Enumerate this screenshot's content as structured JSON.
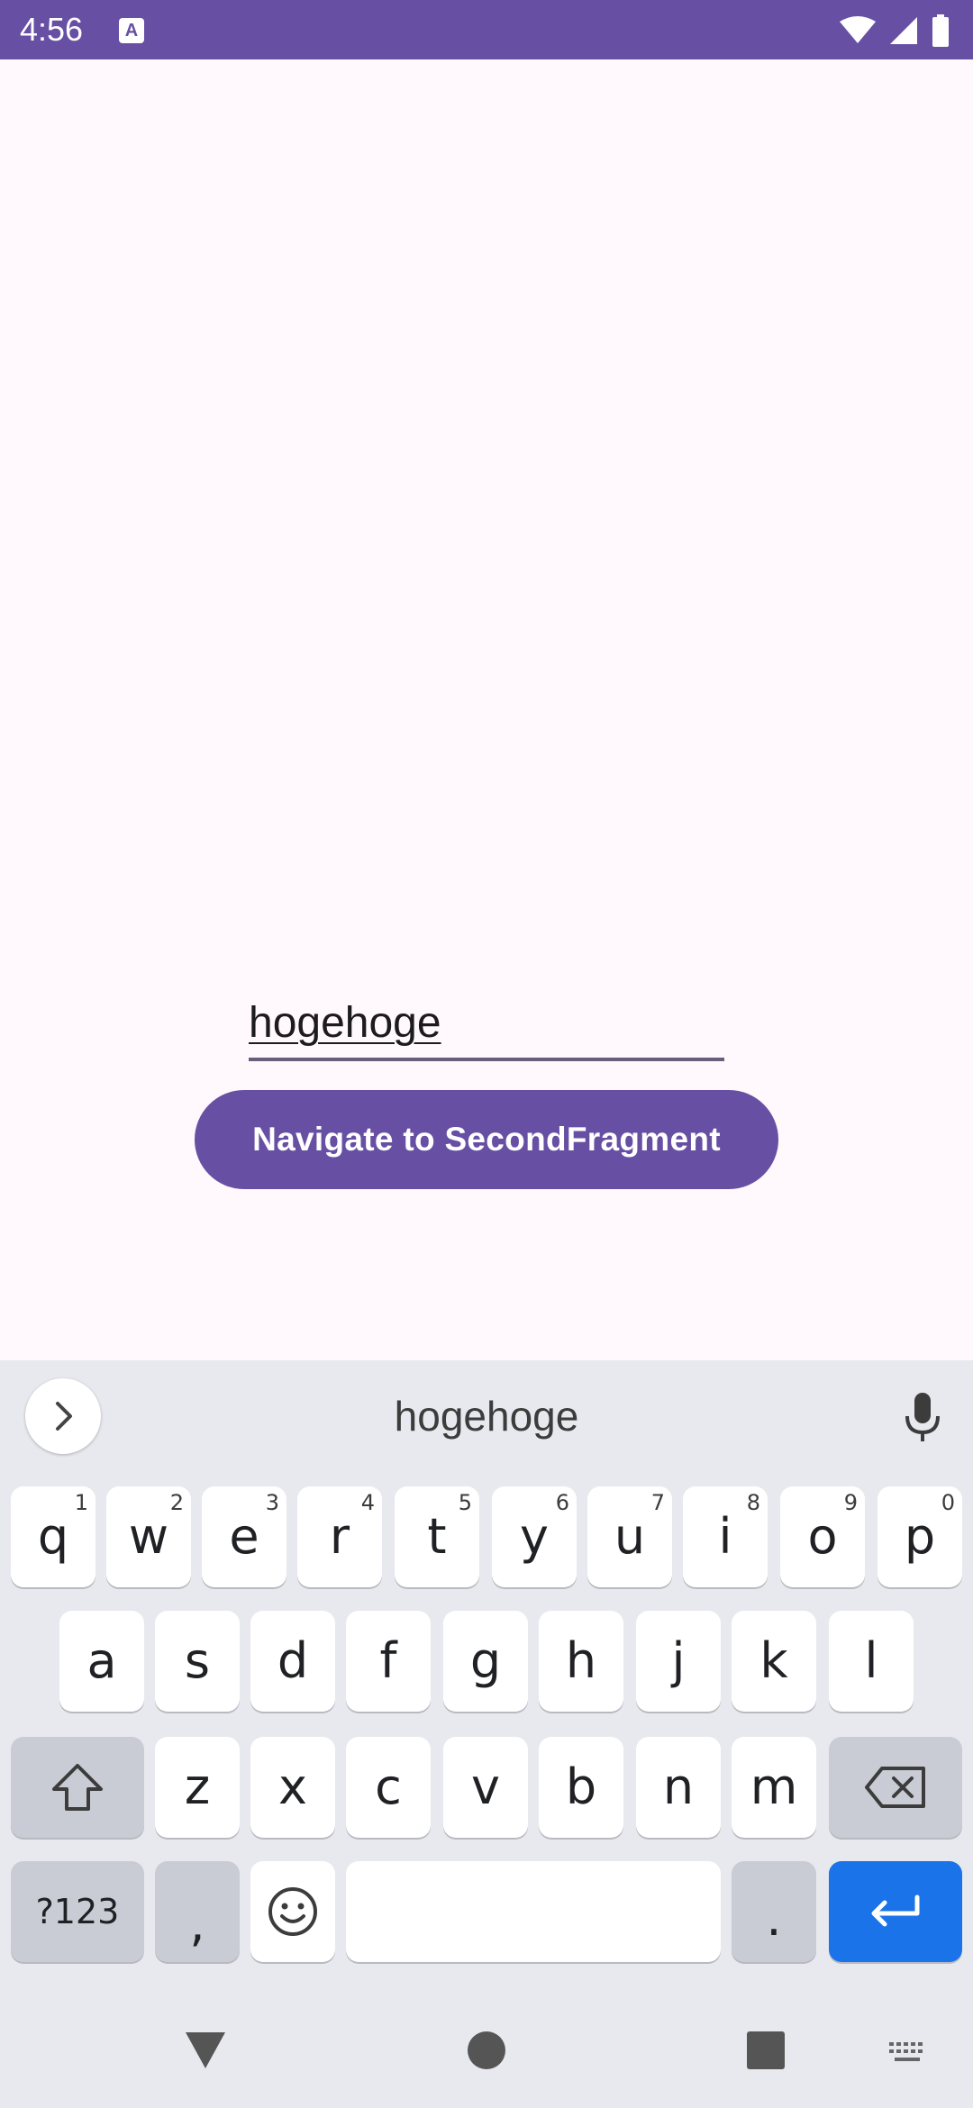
{
  "status_bar": {
    "time": "4:56",
    "notification_glyph": "A",
    "color": "#6750A4",
    "icons": [
      "wifi-icon",
      "signal-icon",
      "battery-icon"
    ]
  },
  "main": {
    "text_field": {
      "value": "hogehoge"
    },
    "navigate_button": {
      "label": "Navigate to SecondFragment",
      "color": "#6750A4"
    }
  },
  "keyboard": {
    "suggestion": "hogehoge",
    "row1": [
      {
        "key": "q",
        "hint": "1"
      },
      {
        "key": "w",
        "hint": "2"
      },
      {
        "key": "e",
        "hint": "3"
      },
      {
        "key": "r",
        "hint": "4"
      },
      {
        "key": "t",
        "hint": "5"
      },
      {
        "key": "y",
        "hint": "6"
      },
      {
        "key": "u",
        "hint": "7"
      },
      {
        "key": "i",
        "hint": "8"
      },
      {
        "key": "o",
        "hint": "9"
      },
      {
        "key": "p",
        "hint": "0"
      }
    ],
    "row2": [
      "a",
      "s",
      "d",
      "f",
      "g",
      "h",
      "j",
      "k",
      "l"
    ],
    "row3": [
      "z",
      "x",
      "c",
      "v",
      "b",
      "n",
      "m"
    ],
    "symbols_key": "?123",
    "comma_key": ",",
    "period_key": ".",
    "enter_color": "#1A73E8"
  },
  "nav_bar": {
    "icons": [
      "back-icon",
      "home-icon",
      "recents-icon",
      "keyboard-switch-icon"
    ]
  }
}
